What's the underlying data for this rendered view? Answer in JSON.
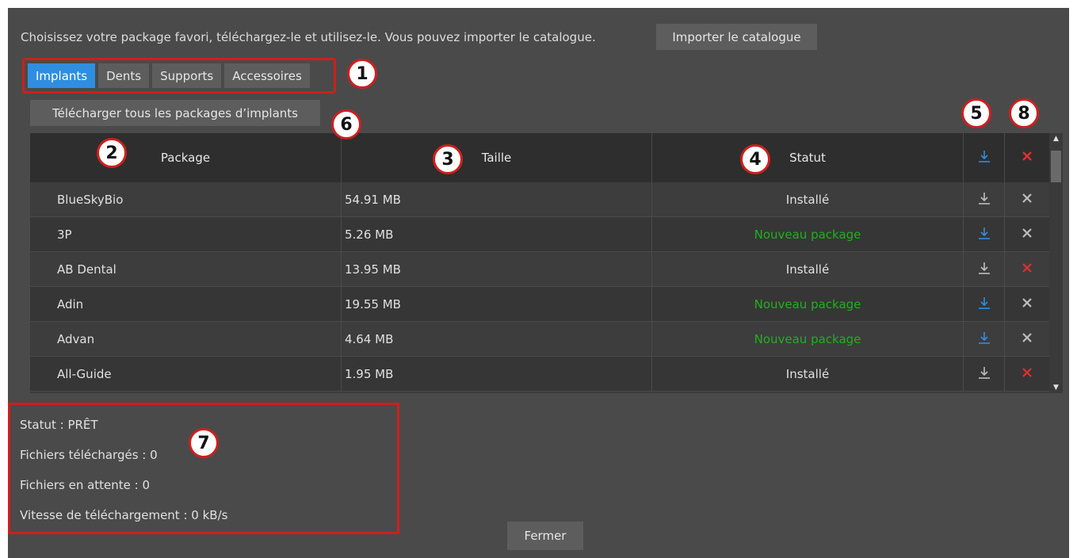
{
  "intro_text": "Choisissez votre package favori, téléchargez-le et utilisez-le.  Vous pouvez importer le catalogue.",
  "import_button": "Importer le catalogue",
  "tabs": [
    {
      "label": "Implants",
      "active": true
    },
    {
      "label": "Dents",
      "active": false
    },
    {
      "label": "Supports",
      "active": false
    },
    {
      "label": "Accessoires",
      "active": false
    }
  ],
  "download_all_button": "Télécharger tous les packages d’implants",
  "table": {
    "columns": {
      "package": "Package",
      "size": "Taille",
      "status": "Statut"
    },
    "rows": [
      {
        "package": "BlueSkyBio",
        "size": "54.91 MB",
        "status": "Installé",
        "is_new": false,
        "download_active": false,
        "delete_active": false
      },
      {
        "package": "3P",
        "size": "5.26 MB",
        "status": "Nouveau package",
        "is_new": true,
        "download_active": true,
        "delete_active": false
      },
      {
        "package": "AB Dental",
        "size": "13.95 MB",
        "status": "Installé",
        "is_new": false,
        "download_active": false,
        "delete_active": true
      },
      {
        "package": "Adin",
        "size": "19.55 MB",
        "status": "Nouveau package",
        "is_new": true,
        "download_active": true,
        "delete_active": false
      },
      {
        "package": "Advan",
        "size": "4.64 MB",
        "status": "Nouveau package",
        "is_new": true,
        "download_active": true,
        "delete_active": false
      },
      {
        "package": "All-Guide",
        "size": "1.95 MB",
        "status": "Installé",
        "is_new": false,
        "download_active": false,
        "delete_active": true
      }
    ]
  },
  "status_panel": {
    "status": "Statut : PRÊT",
    "downloaded": "Fichiers téléchargés :  0",
    "pending": "Fichiers en attente :  0",
    "speed": "Vitesse de téléchargement :  0 kB/s"
  },
  "close_button": "Fermer",
  "callouts": [
    "1",
    "2",
    "3",
    "4",
    "5",
    "6",
    "7",
    "8"
  ],
  "colors": {
    "background": "#4a4a4a",
    "accent_blue": "#2f8ee0",
    "new_green": "#1fb01f",
    "delete_red": "#e03030",
    "callout_red": "#d01e1e",
    "icon_gray": "#bdbdbd"
  },
  "icons": {
    "download": "download-icon",
    "delete": "close-icon"
  }
}
